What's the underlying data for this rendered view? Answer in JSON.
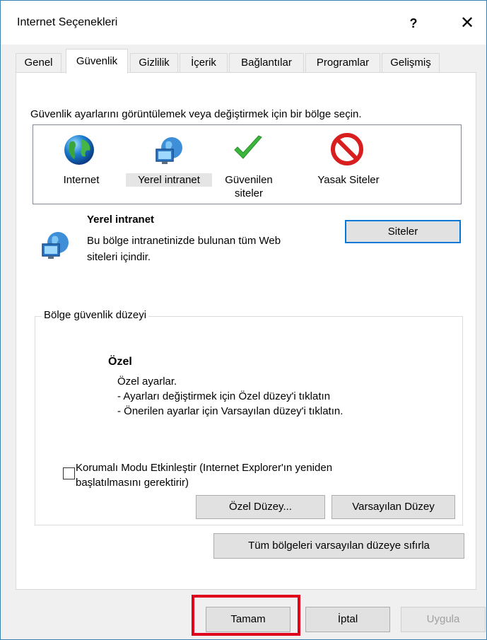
{
  "window": {
    "title": "Internet Seçenekleri",
    "help_label": "?",
    "close_label": "✕"
  },
  "tabs": [
    {
      "label": "Genel"
    },
    {
      "label": "Güvenlik",
      "active": true
    },
    {
      "label": "Gizlilik"
    },
    {
      "label": "İçerik"
    },
    {
      "label": "Bağlantılar"
    },
    {
      "label": "Programlar"
    },
    {
      "label": "Gelişmiş"
    }
  ],
  "security": {
    "instruction": "Güvenlik ayarlarını görüntülemek veya değiştirmek için bir bölge seçin.",
    "zones": [
      {
        "label": "Internet",
        "icon": "globe-icon",
        "selected": false
      },
      {
        "label": "Yerel intranet",
        "icon": "intranet-icon",
        "selected": true
      },
      {
        "label_line1": "Güvenilen",
        "label_line2": "siteler",
        "icon": "checkmark-icon",
        "selected": false
      },
      {
        "label": "Yasak Siteler",
        "icon": "prohibited-icon",
        "selected": false
      }
    ],
    "selected_zone": {
      "name": "Yerel intranet",
      "desc_line1": "Bu bölge intranetinizde bulunan tüm Web",
      "desc_line2": "siteleri içindir.",
      "sites_button": "Siteler"
    },
    "level_group": {
      "title": "Bölge güvenlik düzeyi",
      "level_name": "Özel",
      "line1": "Özel ayarlar.",
      "line2": "- Ayarları değiştirmek için Özel düzey'i tıklatın",
      "line3": "- Önerilen ayarlar için Varsayılan düzey'i tıklatın.",
      "protected_mode_line1": "Korumalı Modu Etkinleştir (Internet Explorer'ın yeniden",
      "protected_mode_line2": "başlatılmasını gerektirir)",
      "protected_mode_checked": false,
      "custom_level_button": "Özel Düzey...",
      "default_level_button": "Varsayılan Düzey"
    },
    "reset_all_button": "Tüm bölgeleri varsayılan düzeye sıfırla"
  },
  "footer": {
    "ok_button": "Tamam",
    "cancel_button": "İptal",
    "apply_button": "Uygula"
  },
  "colors": {
    "accent": "#0078d7",
    "highlight": "#e0001b",
    "selected_zone_bg": "#e5e5e5"
  }
}
